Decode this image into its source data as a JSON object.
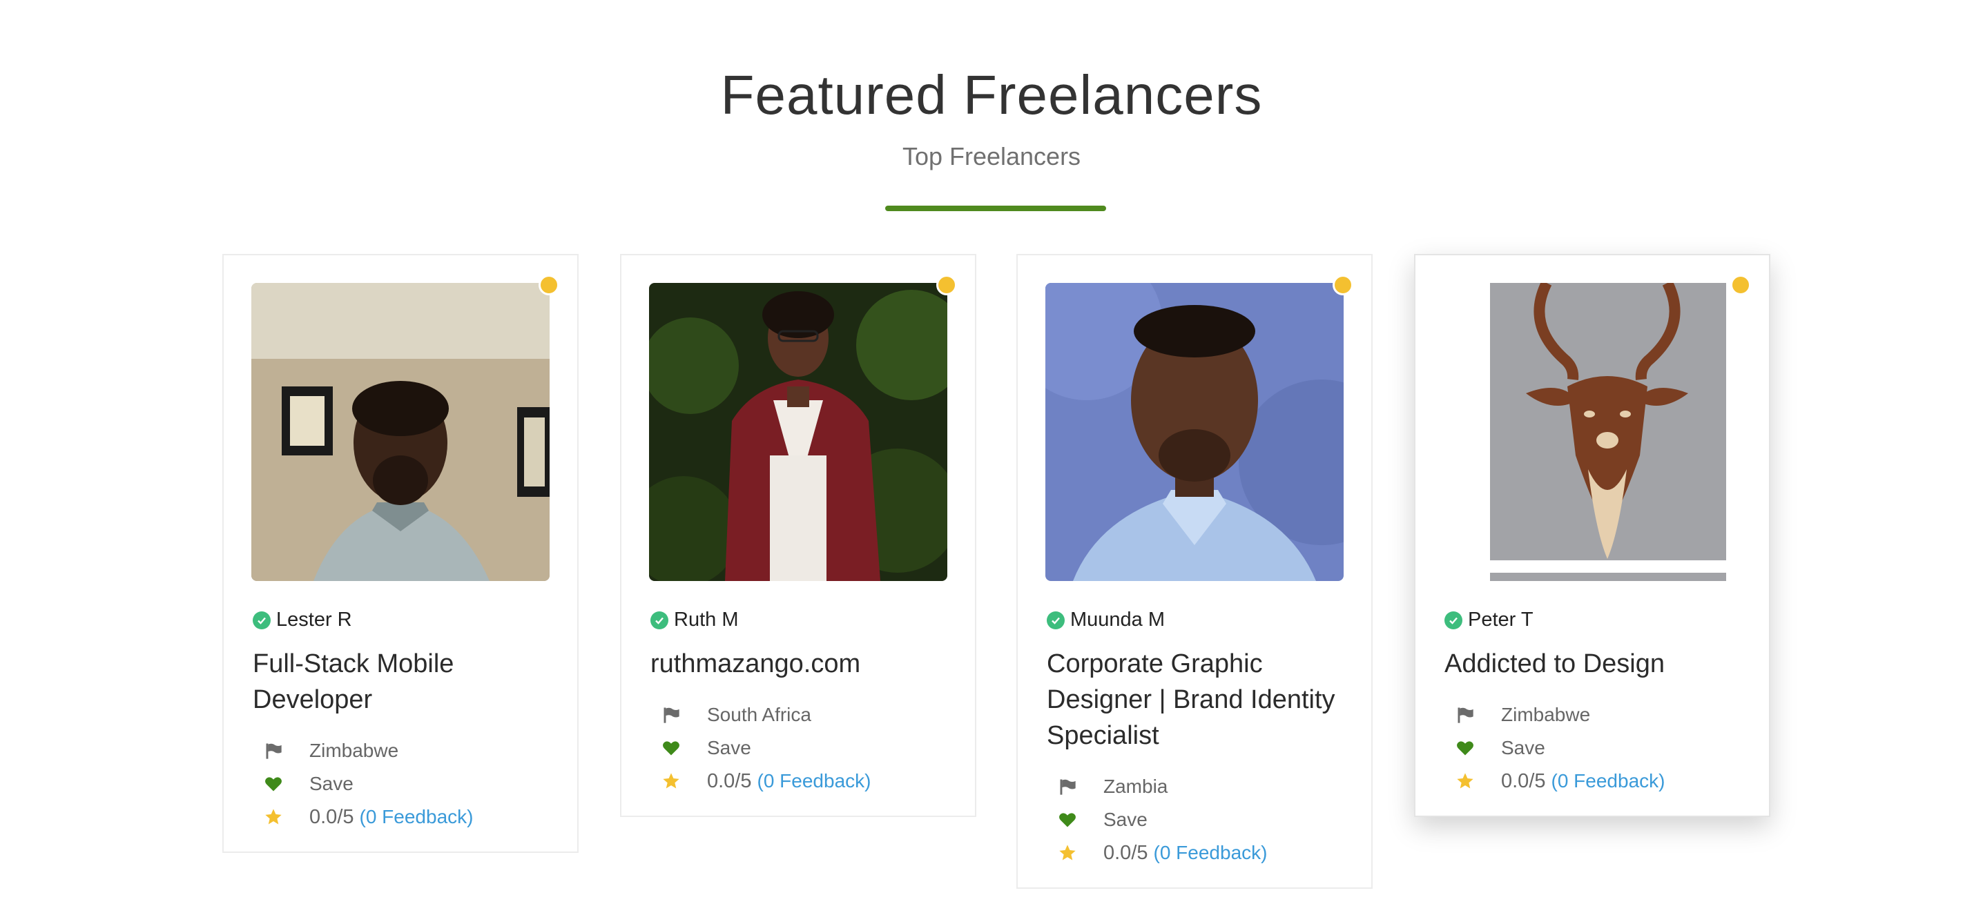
{
  "section": {
    "title": "Featured Freelancers",
    "subtitle": "Top Freelancers"
  },
  "colors": {
    "accent": "#4f8a1e",
    "online": "#f4c030",
    "verified": "#3dbd7d",
    "link": "#3a9ad9",
    "heart": "#3f8a1a",
    "star": "#f4c030"
  },
  "freelancers": [
    {
      "name": "Lester R",
      "headline": "Full-Stack Mobile Developer",
      "country": "Zimbabwe",
      "save_label": "Save",
      "rating": "0.0/5",
      "feedback": "(0 Feedback)"
    },
    {
      "name": "Ruth M",
      "headline": "ruthmazango.com",
      "country": "South Africa",
      "save_label": "Save",
      "rating": "0.0/5",
      "feedback": "(0 Feedback)"
    },
    {
      "name": "Muunda M",
      "headline": "Corporate Graphic Designer | Brand Identity Specialist",
      "country": "Zambia",
      "save_label": "Save",
      "rating": "0.0/5",
      "feedback": "(0 Feedback)"
    },
    {
      "name": "Peter T",
      "headline": "Addicted to Design",
      "country": "Zimbabwe",
      "save_label": "Save",
      "rating": "0.0/5",
      "feedback": "(0 Feedback)"
    }
  ],
  "icons": {
    "verified": "check-circle-icon",
    "country": "flag-icon",
    "save": "heart-icon",
    "rating": "star-icon",
    "status": "online-status-dot"
  }
}
